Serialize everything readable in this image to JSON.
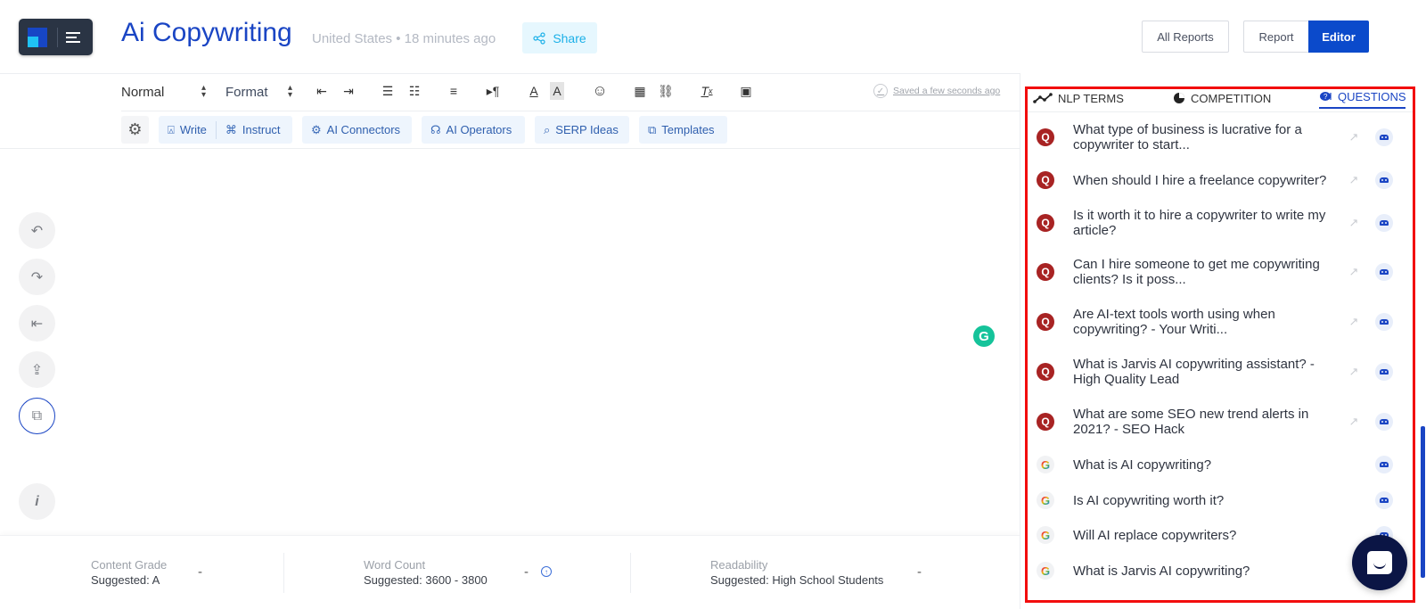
{
  "header": {
    "title": "Ai Copywriting",
    "subtitle": "United States • 18 minutes ago",
    "share_label": "Share",
    "all_reports_label": "All Reports",
    "report_label": "Report",
    "editor_label": "Editor"
  },
  "toolbar": {
    "paragraph_style": "Normal",
    "format_label": "Format",
    "icons": [
      "outdent-icon",
      "indent-icon",
      "ordered-list-icon",
      "bullet-list-icon",
      "align-icon",
      "text-direction-icon",
      "font-color-icon",
      "highlight-icon",
      "emoji-icon",
      "video-icon",
      "link-icon",
      "clear-format-icon",
      "image-icon"
    ],
    "saved_status": "Saved a few seconds ago"
  },
  "ai_toolbar": {
    "write_label": "Write",
    "instruct_label": "Instruct",
    "connectors_label": "AI Connectors",
    "operators_label": "AI Operators",
    "serp_label": "SERP Ideas",
    "templates_label": "Templates"
  },
  "left_rail": [
    "undo-icon",
    "redo-icon",
    "import-icon",
    "export-icon",
    "copy-icon",
    "info-icon"
  ],
  "metrics": {
    "content_grade": {
      "label": "Content Grade",
      "suggested": "Suggested: A",
      "value": "-"
    },
    "word_count": {
      "label": "Word Count",
      "suggested": "Suggested: 3600 - 3800",
      "value": "-"
    },
    "readability": {
      "label": "Readability",
      "suggested": "Suggested: High School Students",
      "value": "-"
    }
  },
  "right_panel": {
    "tabs": [
      {
        "label": "NLP TERMS",
        "icon": "chart-line-icon",
        "active": false
      },
      {
        "label": "COMPETITION",
        "icon": "pie-chart-icon",
        "active": false
      },
      {
        "label": "QUESTIONS",
        "icon": "question-bubble-icon",
        "active": true
      }
    ],
    "questions": [
      {
        "source": "quora",
        "text": "What type of business is lucrative for a copywriter to start...",
        "external": true
      },
      {
        "source": "quora",
        "text": "When should I hire a freelance copywriter?",
        "external": true
      },
      {
        "source": "quora",
        "text": "Is it worth it to hire a copywriter to write my article?",
        "external": true
      },
      {
        "source": "quora",
        "text": "Can I hire someone to get me copywriting clients? Is it poss...",
        "external": true
      },
      {
        "source": "quora",
        "text": "Are AI-text tools worth using when copywriting? - Your Writi...",
        "external": true
      },
      {
        "source": "quora",
        "text": "What is Jarvis AI copywriting assistant? - High Quality Lead",
        "external": true
      },
      {
        "source": "quora",
        "text": "What are some SEO new trend alerts in 2021? - SEO Hack",
        "external": true
      },
      {
        "source": "google",
        "text": "What is AI copywriting?",
        "external": false
      },
      {
        "source": "google",
        "text": "Is AI copywriting worth it?",
        "external": false
      },
      {
        "source": "google",
        "text": "Will AI replace copywriters?",
        "external": false
      },
      {
        "source": "google",
        "text": "What is Jarvis AI copywriting?",
        "external": false
      }
    ]
  },
  "colors": {
    "brand_blue": "#1a45c4",
    "editor_button": "#0b4acb",
    "quora_red": "#a82323",
    "highlight_red": "#f20d0d",
    "grammarly_green": "#15c39a"
  }
}
